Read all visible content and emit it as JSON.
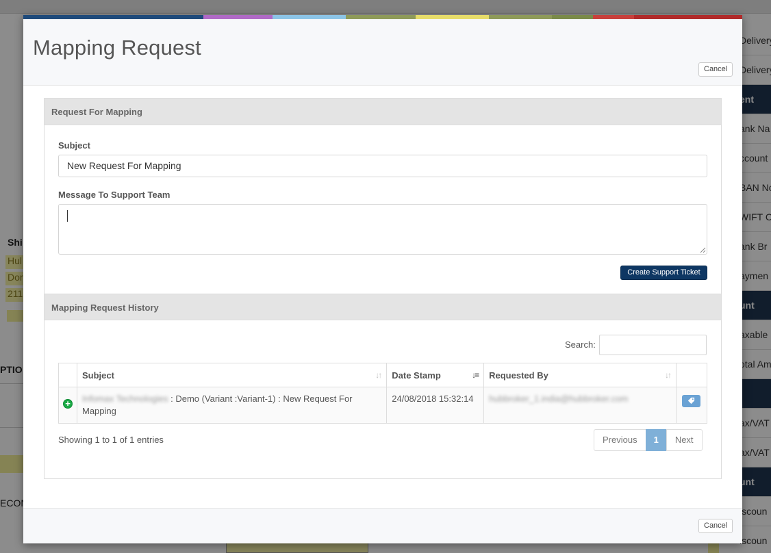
{
  "background": {
    "ship_title": "Shi",
    "ship_lines": [
      "Hul",
      "Dor",
      "211"
    ],
    "options_label": "PTIO",
    "econ_label": "ECON",
    "right_items": [
      {
        "label": "Delivery",
        "dark": false
      },
      {
        "label": "Delivery",
        "dark": false
      },
      {
        "label": "ent",
        "dark": true
      },
      {
        "label": "ank Na",
        "dark": false
      },
      {
        "label": "ccount",
        "dark": false
      },
      {
        "label": "BAN No",
        "dark": false
      },
      {
        "label": "WIFT C",
        "dark": false
      },
      {
        "label": "ank Br",
        "dark": false
      },
      {
        "label": "aymen",
        "dark": false
      },
      {
        "label": "unt",
        "dark": true
      },
      {
        "label": "axable",
        "dark": false
      },
      {
        "label": "otal Am",
        "dark": false
      },
      {
        "label": "",
        "dark": true
      },
      {
        "label": "ax/VAT",
        "dark": false
      },
      {
        "label": "ax/VAT",
        "dark": false
      },
      {
        "label": "unt",
        "dark": true
      },
      {
        "label": "iscoun",
        "dark": false
      },
      {
        "label": "iscoun",
        "dark": false
      }
    ]
  },
  "colors": {
    "stripe": [
      "#1e4a7a",
      "#1e4a7a",
      "#1e4a7a",
      "#b06ac6",
      "#8cc4e6",
      "#8e9a5a",
      "#e6dc6a",
      "#8e9a5a",
      "#7a8a4a",
      "#c8403c",
      "#b02a2a"
    ],
    "primary": "#0e3763",
    "page_active": "#7fb0d8",
    "add_icon": "#1aab46"
  },
  "modal": {
    "title": "Mapping Request",
    "cancel_label": "Cancel",
    "request_panel_title": "Request For Mapping",
    "subject_label": "Subject",
    "subject_value": "New Request For Mapping",
    "message_label": "Message To Support Team",
    "message_value": "",
    "create_button": "Create Support Ticket",
    "history_title": "Mapping Request History",
    "search_label": "Search:",
    "search_value": "",
    "table": {
      "columns": [
        "Subject",
        "Date Stamp",
        "Requested By"
      ],
      "rows": [
        {
          "subject_blurred": "Infomax Technologies",
          "subject_rest": " : Demo (Variant :Variant-1) : New Request For Mapping",
          "date_stamp": "24/08/2018 15:32:14",
          "requested_by": "hubbroker_1.india@hubbroker.com"
        }
      ]
    },
    "showing_text": "Showing 1 to 1 of 1 entries",
    "pagination": {
      "previous": "Previous",
      "current": "1",
      "next": "Next"
    }
  }
}
